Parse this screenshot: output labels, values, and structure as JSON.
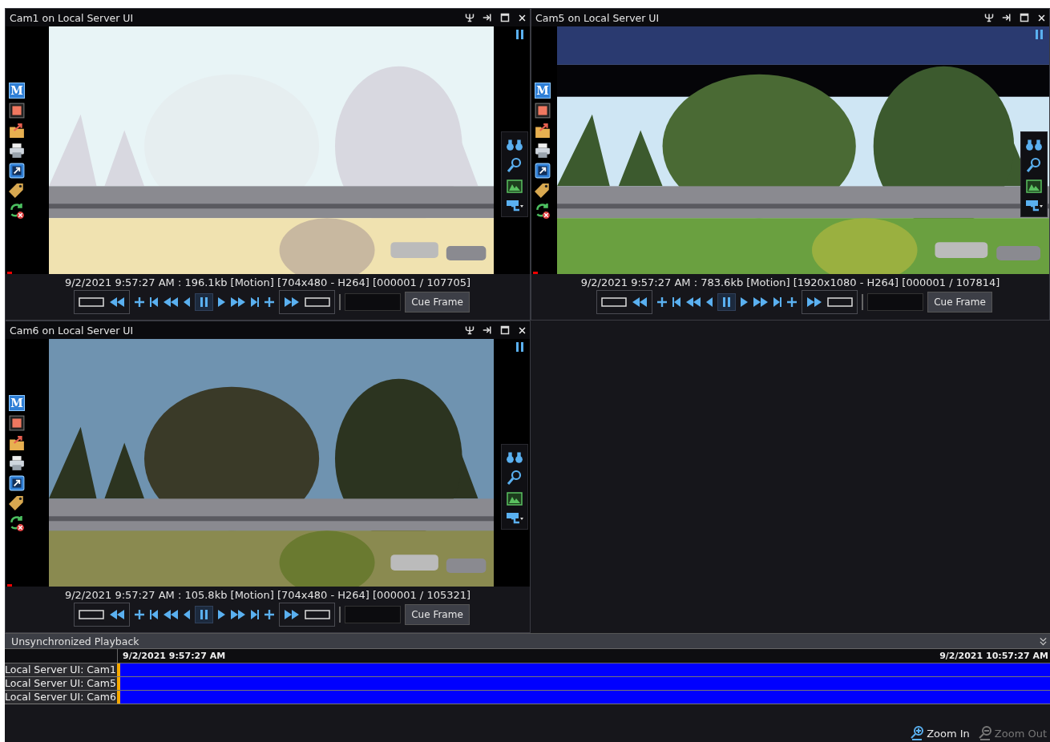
{
  "cameras": [
    {
      "title": "Cam1 on Local Server UI",
      "mode_letter": "M",
      "info": "9/2/2021 9:57:27 AM : 196.1kb [Motion] [704x480 - H264] [000001 / 107705]",
      "paused": true,
      "cue_label": "Cue Frame"
    },
    {
      "title": "Cam5 on Local Server UI",
      "mode_letter": "M",
      "info": "9/2/2021 9:57:27 AM : 783.6kb [Motion] [1920x1080 - H264] [000001 / 107814]",
      "paused": true,
      "cue_label": "Cue Frame"
    },
    {
      "title": "Cam6 on Local Server UI",
      "mode_letter": "M",
      "info": "9/2/2021 9:57:27 AM : 105.8kb [Motion] [704x480 - H264] [000001 / 105321]",
      "paused": true,
      "cue_label": "Cue Frame"
    }
  ],
  "timeline": {
    "title": "Unsynchronized Playback",
    "start": "9/2/2021 9:57:27 AM",
    "end": "9/2/2021 10:57:27 AM",
    "tracks": [
      {
        "label": "Local Server UI: Cam1"
      },
      {
        "label": "Local Server UI: Cam5"
      },
      {
        "label": "Local Server UI: Cam6"
      }
    ],
    "zoom_buttons": [
      {
        "kind": "in",
        "label": "Zoom In",
        "disabled": false
      },
      {
        "kind": "out",
        "label": "Zoom Out",
        "disabled": true
      }
    ]
  }
}
